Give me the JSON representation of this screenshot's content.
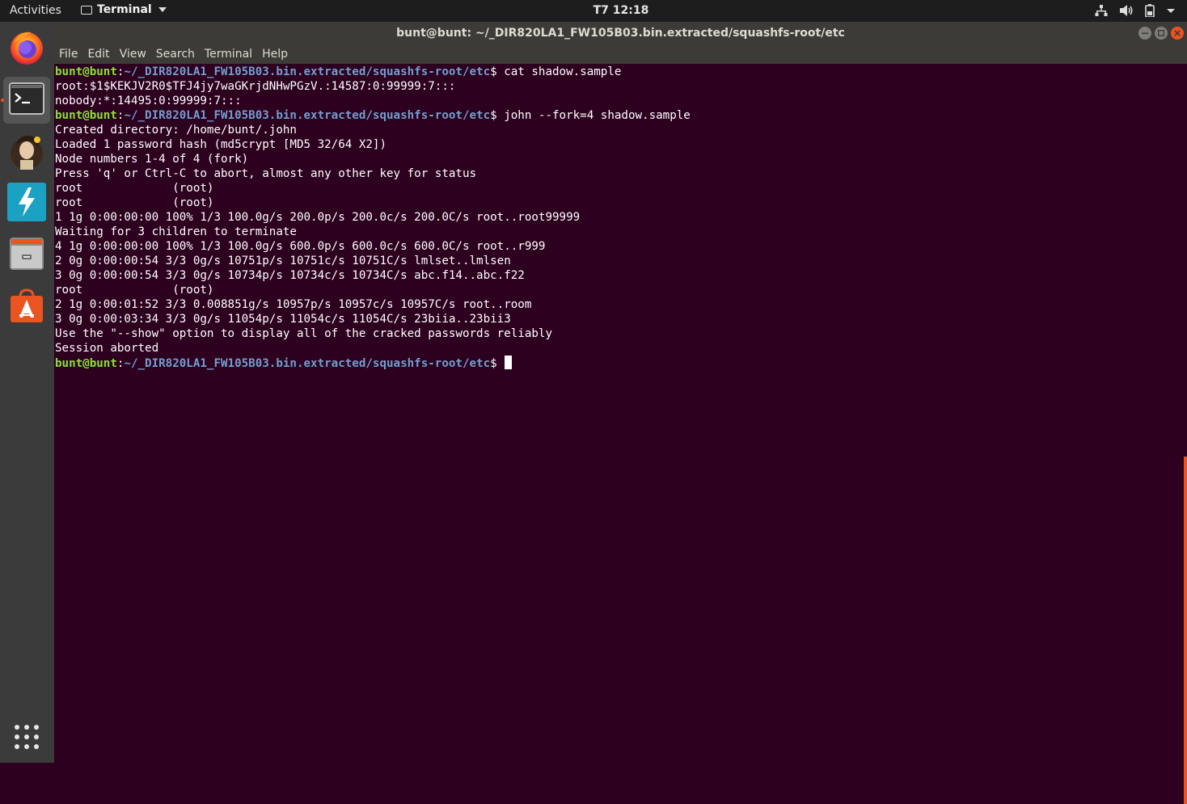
{
  "topbar": {
    "activities": "Activities",
    "app_name": "Terminal",
    "clock": "T7 12:18",
    "tray_icons": [
      "network-icon",
      "volume-icon",
      "battery-icon",
      "system-menu-caret-icon"
    ]
  },
  "dock": {
    "items": [
      {
        "name": "firefox-icon",
        "active": false
      },
      {
        "name": "terminal-icon",
        "active": true
      },
      {
        "name": "user-avatar-app-icon",
        "active": false
      },
      {
        "name": "bolt-app-icon",
        "active": false
      },
      {
        "name": "files-icon",
        "active": false
      },
      {
        "name": "software-store-icon",
        "active": false
      }
    ],
    "apps_grid_icon": "show-applications-icon"
  },
  "window": {
    "title": "bunt@bunt: ~/_DIR820LA1_FW105B03.bin.extracted/squashfs-root/etc",
    "menu": [
      "File",
      "Edit",
      "View",
      "Search",
      "Terminal",
      "Help"
    ]
  },
  "terminal": {
    "user_host": "bunt@bunt",
    "cwd": "~/_DIR820LA1_FW105B03.bin.extracted/squashfs-root/etc",
    "lines": [
      {
        "type": "prompt",
        "cmd": " cat shadow.sample"
      },
      {
        "type": "out",
        "text": "root:$1$KEKJV2R0$TFJ4jy7waGKrjdNHwPGzV.:14587:0:99999:7:::"
      },
      {
        "type": "out",
        "text": "nobody:*:14495:0:99999:7:::"
      },
      {
        "type": "prompt",
        "cmd": " john --fork=4 shadow.sample"
      },
      {
        "type": "out",
        "text": "Created directory: /home/bunt/.john"
      },
      {
        "type": "out",
        "text": "Loaded 1 password hash (md5crypt [MD5 32/64 X2])"
      },
      {
        "type": "out",
        "text": "Node numbers 1-4 of 4 (fork)"
      },
      {
        "type": "out",
        "text": "Press 'q' or Ctrl-C to abort, almost any other key for status"
      },
      {
        "type": "out",
        "text": "root             (root)"
      },
      {
        "type": "out",
        "text": "root             (root)"
      },
      {
        "type": "out",
        "text": "1 1g 0:00:00:00 100% 1/3 100.0g/s 200.0p/s 200.0c/s 200.0C/s root..root99999"
      },
      {
        "type": "out",
        "text": "Waiting for 3 children to terminate"
      },
      {
        "type": "out",
        "text": "4 1g 0:00:00:00 100% 1/3 100.0g/s 600.0p/s 600.0c/s 600.0C/s root..r999"
      },
      {
        "type": "out",
        "text": "2 0g 0:00:00:54 3/3 0g/s 10751p/s 10751c/s 10751C/s lmlset..lmlsen"
      },
      {
        "type": "out",
        "text": "3 0g 0:00:00:54 3/3 0g/s 10734p/s 10734c/s 10734C/s abc.f14..abc.f22"
      },
      {
        "type": "out",
        "text": "root             (root)"
      },
      {
        "type": "out",
        "text": "2 1g 0:00:01:52 3/3 0.008851g/s 10957p/s 10957c/s 10957C/s root..room"
      },
      {
        "type": "out",
        "text": "3 0g 0:00:03:34 3/3 0g/s 11054p/s 11054c/s 11054C/s 23biia..23bii3"
      },
      {
        "type": "out",
        "text": "Use the \"--show\" option to display all of the cracked passwords reliably"
      },
      {
        "type": "out",
        "text": "Session aborted"
      },
      {
        "type": "prompt",
        "cmd": " ",
        "cursor": true
      }
    ]
  },
  "colors": {
    "terminal_bg": "#2c001e",
    "prompt_user": "#8ae234",
    "prompt_path": "#729fcf",
    "accent": "#e95420"
  }
}
